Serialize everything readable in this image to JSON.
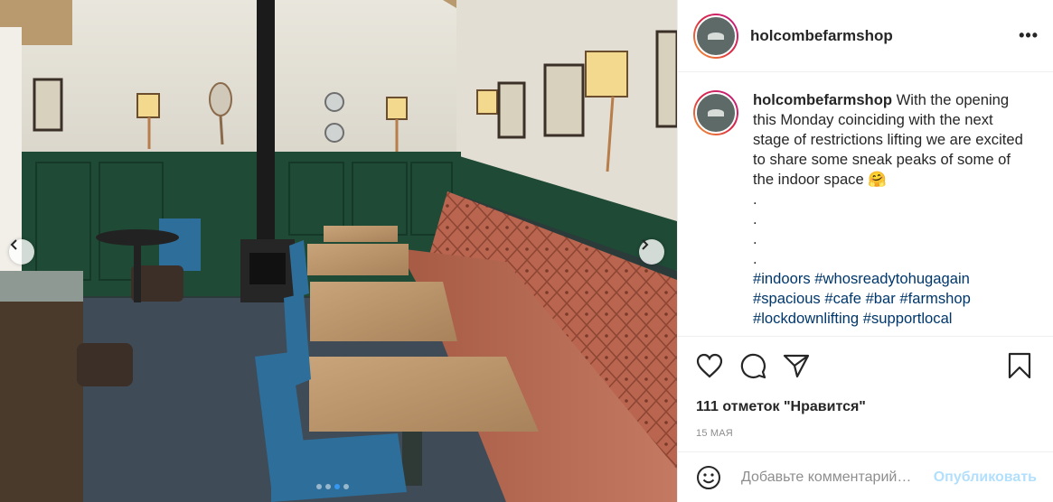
{
  "post": {
    "username": "holcombefarmshop",
    "more_icon": "more-horizontal-icon",
    "caption": {
      "username": "holcombefarmshop",
      "text": "With the opening this Monday coinciding with the next stage of restrictions lifting we are excited to share some sneak peaks of some of the indoor space 🤗",
      "dot_lines": [
        ".",
        ".",
        ".",
        "."
      ],
      "hashtags": [
        "#indoors",
        "#whosreadytohugagain",
        "#spacious",
        "#cafe",
        "#bar",
        "#farmshop",
        "#lockdownlifting",
        "#supportlocal"
      ]
    },
    "likes_text": "111 отметок \"Нравится\"",
    "date": "15 МАЯ",
    "comment": {
      "placeholder": "Добавьте комментарий…",
      "publish_label": "Опубликовать"
    },
    "carousel": {
      "slide_count": 4,
      "active_index": 2
    }
  },
  "colors": {
    "accent": "#3897f0",
    "publish_disabled": "#b2dffc",
    "hashtag": "#00376b",
    "muted": "#8e8e8e"
  }
}
